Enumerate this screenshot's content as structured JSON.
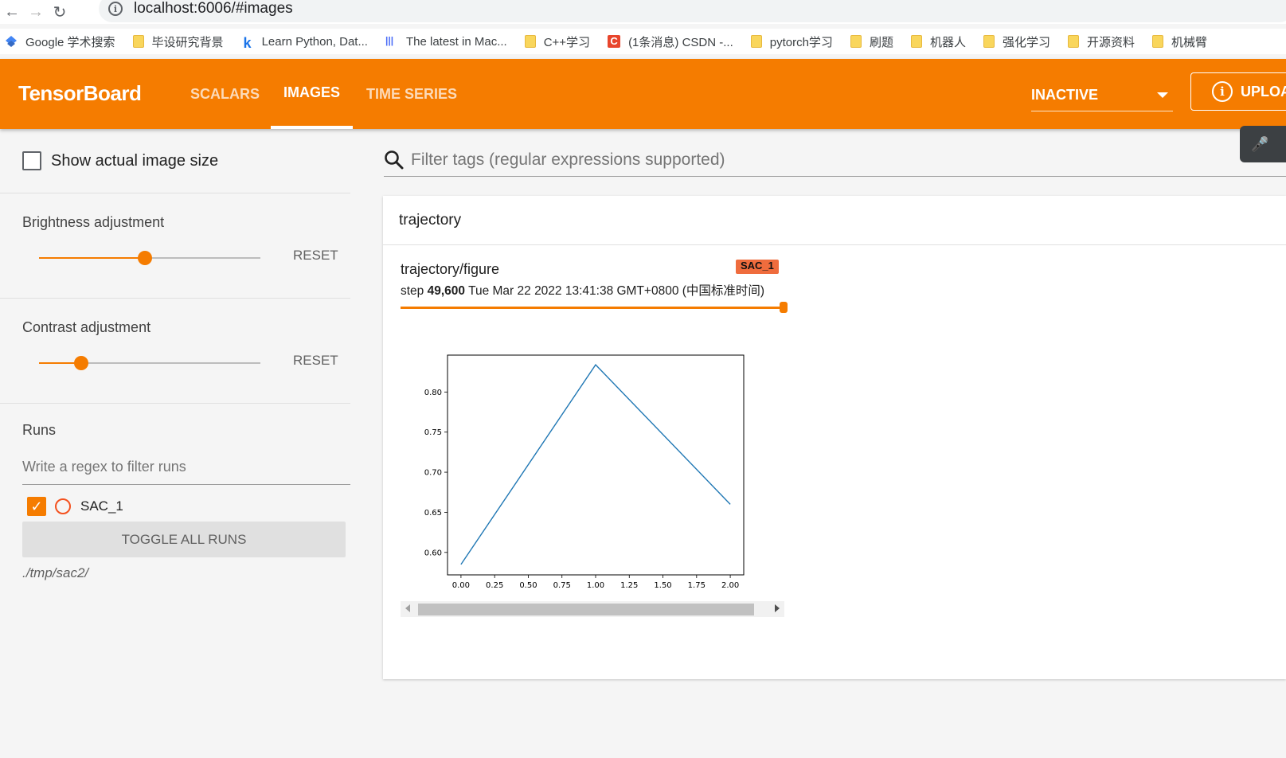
{
  "browser": {
    "url": "localhost:6006/#images",
    "bookmarks": [
      {
        "label": "Google 学术搜索",
        "icon": "google-scholar-icon"
      },
      {
        "label": "毕设研究背景",
        "icon": "folder-icon"
      },
      {
        "label": "Learn Python, Dat...",
        "icon": "kaggle-icon"
      },
      {
        "label": "The latest in Mac...",
        "icon": "papers-with-code-icon"
      },
      {
        "label": "C++学习",
        "icon": "folder-icon"
      },
      {
        "label": "(1条消息) CSDN -...",
        "icon": "csdn-icon"
      },
      {
        "label": "pytorch学习",
        "icon": "folder-icon"
      },
      {
        "label": "刷题",
        "icon": "folder-icon"
      },
      {
        "label": "机器人",
        "icon": "folder-icon"
      },
      {
        "label": "强化学习",
        "icon": "folder-icon"
      },
      {
        "label": "开源资料",
        "icon": "folder-icon"
      },
      {
        "label": "机械臂",
        "icon": "folder-icon"
      }
    ]
  },
  "header": {
    "logo": "TensorBoard",
    "tabs": [
      {
        "label": "SCALARS",
        "active": false
      },
      {
        "label": "IMAGES",
        "active": true
      },
      {
        "label": "TIME SERIES",
        "active": false
      }
    ],
    "status_select": "INACTIVE",
    "upload_label": "UPLOA",
    "accent_color": "#f57c00"
  },
  "sidebar": {
    "show_actual_size_label": "Show actual image size",
    "brightness": {
      "title": "Brightness adjustment",
      "value": 0.48,
      "reset": "RESET"
    },
    "contrast": {
      "title": "Contrast adjustment",
      "value": 0.19,
      "reset": "RESET"
    },
    "runs_title": "Runs",
    "runs_filter_placeholder": "Write a regex to filter runs",
    "runs": [
      {
        "name": "SAC_1",
        "checked": true,
        "color": "#f4511e"
      }
    ],
    "toggle_all_label": "TOGGLE ALL RUNS",
    "logdir": "./tmp/sac2/"
  },
  "main": {
    "filter_placeholder": "Filter tags (regular expressions supported)",
    "group_title": "trajectory",
    "image_card": {
      "title": "trajectory/figure",
      "run_badge": "SAC_1",
      "step_prefix": "step",
      "step_value": "49,600",
      "timestamp": "Tue Mar 22 2022 13:41:38 GMT+0800 (中国标准时间)",
      "step_position": 1.0
    }
  },
  "chart_data": {
    "type": "line",
    "x": [
      0.0,
      1.0,
      2.0
    ],
    "series": [
      {
        "values": [
          0.585,
          0.834,
          0.66
        ],
        "color": "#1f77b4"
      }
    ],
    "xlim": [
      -0.1,
      2.1
    ],
    "ylim": [
      0.572,
      0.846
    ],
    "xticks": [
      "0.00",
      "0.25",
      "0.50",
      "0.75",
      "1.00",
      "1.25",
      "1.50",
      "1.75",
      "2.00"
    ],
    "yticks": [
      "0.60",
      "0.65",
      "0.70",
      "0.75",
      "0.80"
    ],
    "grid": false
  }
}
